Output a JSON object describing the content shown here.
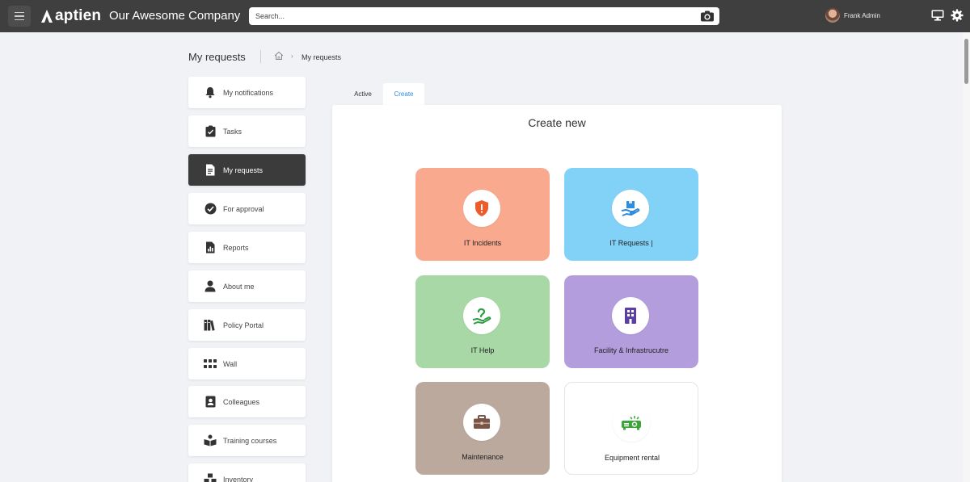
{
  "app": {
    "logo_text": "aptien",
    "company": "Our Awesome Company",
    "search_placeholder": "Search...",
    "user_name": "Frank Admin"
  },
  "header": {
    "title": "My requests",
    "breadcrumb_current": "My requests",
    "breadcrumb_separator": "›"
  },
  "sidebar": {
    "items": [
      {
        "label": "My notifications",
        "icon": "bell-icon"
      },
      {
        "label": "Tasks",
        "icon": "clipboard-check-icon"
      },
      {
        "label": "My requests",
        "icon": "document-icon",
        "active": true
      },
      {
        "label": "For approval",
        "icon": "check-circle-icon"
      },
      {
        "label": "Reports",
        "icon": "report-icon"
      },
      {
        "label": "About me",
        "icon": "person-icon"
      },
      {
        "label": "Policy Portal",
        "icon": "books-icon"
      },
      {
        "label": "Wall",
        "icon": "grid-icon"
      },
      {
        "label": "Colleagues",
        "icon": "contact-card-icon"
      },
      {
        "label": "Training courses",
        "icon": "reading-icon"
      },
      {
        "label": "Inventory",
        "icon": "boxes-icon"
      }
    ]
  },
  "tabs": {
    "active_label": "Active",
    "create_label": "Create"
  },
  "panel": {
    "title": "Create new",
    "cards": [
      {
        "label": "IT Incidents",
        "color": "#f9a98d",
        "icon": "shield-alert-icon"
      },
      {
        "label": "IT Requests |",
        "color": "#82d1f7",
        "icon": "hand-box-icon"
      },
      {
        "label": "IT Help",
        "color": "#a8d8a6",
        "icon": "hand-help-icon"
      },
      {
        "label": "Facility & Infrastrucutre",
        "color": "#b39ddd",
        "icon": "building-icon"
      },
      {
        "label": "Maintenance",
        "color": "#bba99d",
        "icon": "toolbox-icon"
      },
      {
        "label": "Equipment rental",
        "color": "#ffffff",
        "icon": "projector-icon"
      }
    ]
  },
  "colors": {
    "topbar": "#3f3f3f",
    "accent": "#2d8ce0",
    "active_sidebar": "#3b3b3b"
  }
}
